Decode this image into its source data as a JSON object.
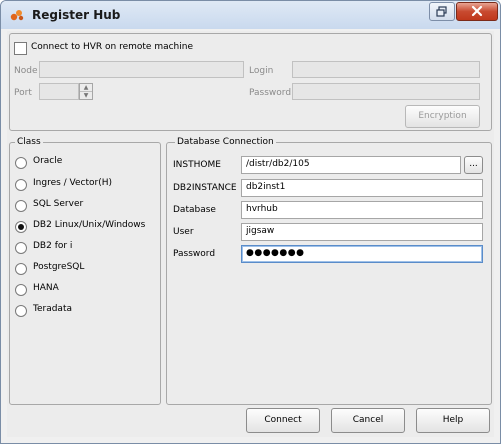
{
  "window": {
    "title": "Register Hub"
  },
  "remote": {
    "checkbox_label": "Connect to HVR on remote machine",
    "node_label": "Node",
    "port_label": "Port",
    "login_label": "Login",
    "password_label": "Password",
    "encryption_label": "Encryption"
  },
  "class_panel": {
    "legend": "Class",
    "options": [
      {
        "label": "Oracle",
        "selected": false
      },
      {
        "label": "Ingres / Vector(H)",
        "selected": false
      },
      {
        "label": "SQL Server",
        "selected": false
      },
      {
        "label": "DB2 Linux/Unix/Windows",
        "selected": true
      },
      {
        "label": "DB2 for i",
        "selected": false
      },
      {
        "label": "PostgreSQL",
        "selected": false
      },
      {
        "label": "HANA",
        "selected": false
      },
      {
        "label": "Teradata",
        "selected": false
      }
    ]
  },
  "db_panel": {
    "legend": "Database Connection",
    "browse_label": "...",
    "fields": [
      {
        "label": "INSTHOME",
        "value": "/distr/db2/105"
      },
      {
        "label": "DB2INSTANCE",
        "value": "db2inst1"
      },
      {
        "label": "Database",
        "value": "hvrhub"
      },
      {
        "label": "User",
        "value": "jigsaw"
      },
      {
        "label": "Password",
        "value": "●●●●●●●"
      }
    ]
  },
  "buttons": {
    "connect": "Connect",
    "cancel": "Cancel",
    "help": "Help"
  }
}
